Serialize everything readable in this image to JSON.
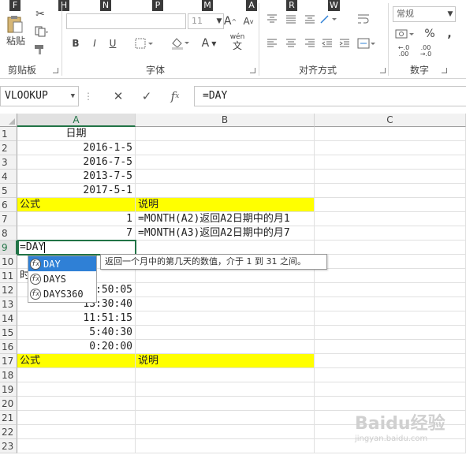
{
  "ribbon": {
    "keytips": [
      "F",
      "H",
      "N",
      "P",
      "M",
      "A",
      "R",
      "W"
    ],
    "clipboard": {
      "label": "剪贴板",
      "paste_label": "粘贴"
    },
    "font": {
      "label": "字体",
      "size_value": "11",
      "wen_label": "wén"
    },
    "alignment": {
      "label": "对齐方式"
    },
    "number": {
      "label": "数字",
      "format_value": "常规"
    }
  },
  "formula_bar": {
    "name_box": "VLOOKUP",
    "formula": "=DAY"
  },
  "columns": [
    "A",
    "B",
    "C"
  ],
  "rows": [
    "1",
    "2",
    "3",
    "4",
    "5",
    "6",
    "7",
    "8",
    "9",
    "10",
    "11",
    "12",
    "13",
    "14",
    "15",
    "16",
    "17",
    "18",
    "19",
    "20",
    "21",
    "22",
    "23"
  ],
  "cells": {
    "A1": "日期",
    "A2": "2016-1-5",
    "A3": "2016-7-5",
    "A4": "2013-7-5",
    "A5": "2017-5-1",
    "A6": "公式",
    "B6": "说明",
    "A7": "1",
    "B7": "=MONTH(A2)返回A2日期中的月1",
    "A8": "7",
    "B8": "=MONTH(A3)返回A2日期中的月7",
    "A9": "=DAY",
    "A10": "时",
    "A11": ":50:05",
    "A12": "13:30:40",
    "A13": "11:51:15",
    "A14": "5:40:30",
    "A15": "0:20:00",
    "A17": "公式",
    "B17": "说明"
  },
  "autocomplete": {
    "items": [
      "DAY",
      "DAYS",
      "DAYS360"
    ],
    "tooltip": "返回一个月中的第几天的数值，介于 1 到 31 之间。"
  },
  "watermark": {
    "text": "Baidu经验",
    "sub": "jingyan.baidu.com"
  },
  "colors": {
    "accent": "#217346",
    "highlight": "#ffff00",
    "selection": "#2f80d6"
  }
}
